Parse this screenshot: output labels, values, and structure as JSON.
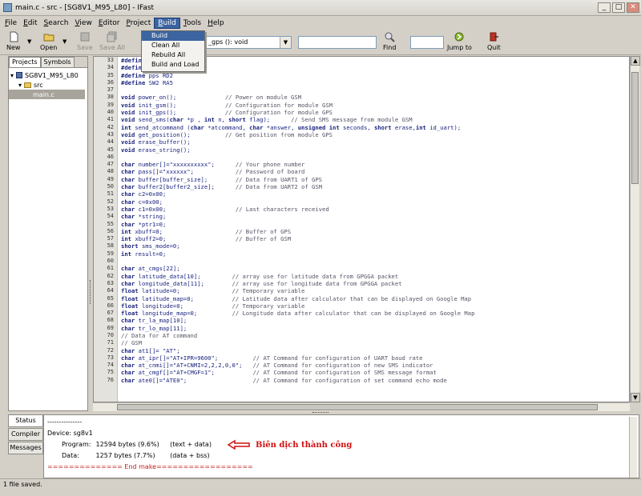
{
  "window": {
    "title": "main.c - src - [SG8V1_M95_L80] - IFast"
  },
  "menu": [
    {
      "label": "File",
      "u": "F"
    },
    {
      "label": "Edit",
      "u": "E"
    },
    {
      "label": "Search",
      "u": "S"
    },
    {
      "label": "View",
      "u": "V"
    },
    {
      "label": "Editor",
      "u": "E"
    },
    {
      "label": "Project",
      "u": "P"
    },
    {
      "label": "Build",
      "u": "B"
    },
    {
      "label": "Tools",
      "u": "T"
    },
    {
      "label": "Help",
      "u": "H"
    }
  ],
  "build_menu": {
    "items": [
      "Build",
      "Clean All",
      "Rebuild All",
      "Build and Load"
    ]
  },
  "toolbar": {
    "new": "New",
    "open": "Open",
    "save": "Save",
    "save_all": "Save All",
    "function_combo": "_gps (): void",
    "find": "Find",
    "jump_to": "Jump to",
    "quit": "Quit"
  },
  "side": {
    "tab_projects": "Projects",
    "tab_symbols": "Symbols",
    "tree": {
      "project": "SG8V1_M95_L80",
      "folder": "src",
      "file": "main.c"
    }
  },
  "editor": {
    "lines": [
      {
        "n": "33",
        "t": "#define"
      },
      {
        "n": "34",
        "t": "#define"
      },
      {
        "n": "35",
        "t": "#define pps RD2"
      },
      {
        "n": "36",
        "t": "#define SW2 RA5"
      },
      {
        "n": "37",
        "t": ""
      },
      {
        "n": "38",
        "t": "void power_on();              // Power on module GSM"
      },
      {
        "n": "39",
        "t": "void init_gsm();              // Configuration for module GSM"
      },
      {
        "n": "40",
        "t": "void init_gps();              // Configuration for module GPS"
      },
      {
        "n": "41",
        "t": "void send_sms(char *p , int n, short flag);      // Send SMS message from module GSM"
      },
      {
        "n": "42",
        "t": "int send_atcommand (char *atcommand, char *answer, unsigned int seconds, short erase,int id_uart);"
      },
      {
        "n": "43",
        "t": "void get_position();          // Get position from module GPS"
      },
      {
        "n": "44",
        "t": "void erase_buffer();"
      },
      {
        "n": "45",
        "t": "void erase_string();"
      },
      {
        "n": "46",
        "t": ""
      },
      {
        "n": "47",
        "t": "char number[]=\"xxxxxxxxxx\";      // Your phone number"
      },
      {
        "n": "48",
        "t": "char pass[]=\"xxxxxx\";            // Password of board"
      },
      {
        "n": "49",
        "t": "char buffer[buffer_size];        // Data from UART1 of GPS"
      },
      {
        "n": "50",
        "t": "char buffer2[buffer2_size];      // Data from UART2 of GSM"
      },
      {
        "n": "51",
        "t": "char c2=0x00;"
      },
      {
        "n": "52",
        "t": "char c=0x00;"
      },
      {
        "n": "53",
        "t": "char c1=0x00;                    // Last characters received"
      },
      {
        "n": "54",
        "t": "char *string;"
      },
      {
        "n": "55",
        "t": "char *ptr1=0;"
      },
      {
        "n": "56",
        "t": "int xbuff=0;                     // Buffer of GPS"
      },
      {
        "n": "57",
        "t": "int xbuff2=0;                    // Buffer of GSM"
      },
      {
        "n": "58",
        "t": "short sms_mode=0;"
      },
      {
        "n": "59",
        "t": "int result=0;"
      },
      {
        "n": "60",
        "t": ""
      },
      {
        "n": "61",
        "t": "char at_cmgs[22];"
      },
      {
        "n": "62",
        "t": "char latitude_data[10];         // array use for latitude data from GPGGA packet"
      },
      {
        "n": "63",
        "t": "char longitude_data[11];        // array use for longitude data from GPGGA packet"
      },
      {
        "n": "64",
        "t": "float latitude=0;               // Temporary variable"
      },
      {
        "n": "65",
        "t": "float latitude_map=0;           // Latitude data after calculator that can be displayed on Google Map"
      },
      {
        "n": "66",
        "t": "float longitude=0;              // Temporary variable"
      },
      {
        "n": "67",
        "t": "float longitude_map=0;          // Longitude data after calculator that can be displayed on Google Map"
      },
      {
        "n": "68",
        "t": "char tr_la_map[10];"
      },
      {
        "n": "69",
        "t": "char tr_lo_map[11];"
      },
      {
        "n": "70",
        "t": "// Data for AT command"
      },
      {
        "n": "71",
        "t": "// GSM"
      },
      {
        "n": "72",
        "t": "char at1[]= \"AT\";"
      },
      {
        "n": "73",
        "t": "char at_ipr[]=\"AT+IPR=9600\";          // AT Command for configuration of UART baud rate"
      },
      {
        "n": "74",
        "t": "char at_cnmi[]=\"AT+CNMI=2,2,2,0,0\";   // AT Command for configuration of new SMS indicator"
      },
      {
        "n": "75",
        "t": "char at_cmgf[]=\"AT+CMGF=1\";           // AT Command for configuration of SMS message format"
      },
      {
        "n": "76",
        "t": "char ate0[]=\"ATE0\";                   // AT Command for configuration of set command echo mode"
      }
    ]
  },
  "output_tabs": [
    "Status",
    "Compiler",
    "Messages"
  ],
  "output": {
    "sep": "---------------",
    "device": "Device: sg8v1",
    "program_label": "Program:",
    "program_val": "12594 bytes (9.6%)",
    "program_note": "(text + data)",
    "data_label": "Data:",
    "data_val": "1257 bytes (7.7%)",
    "data_note": "(data + bss)",
    "end": "============== End make==================",
    "annotation": "Biên dịch thành công"
  },
  "status": "1 file saved."
}
